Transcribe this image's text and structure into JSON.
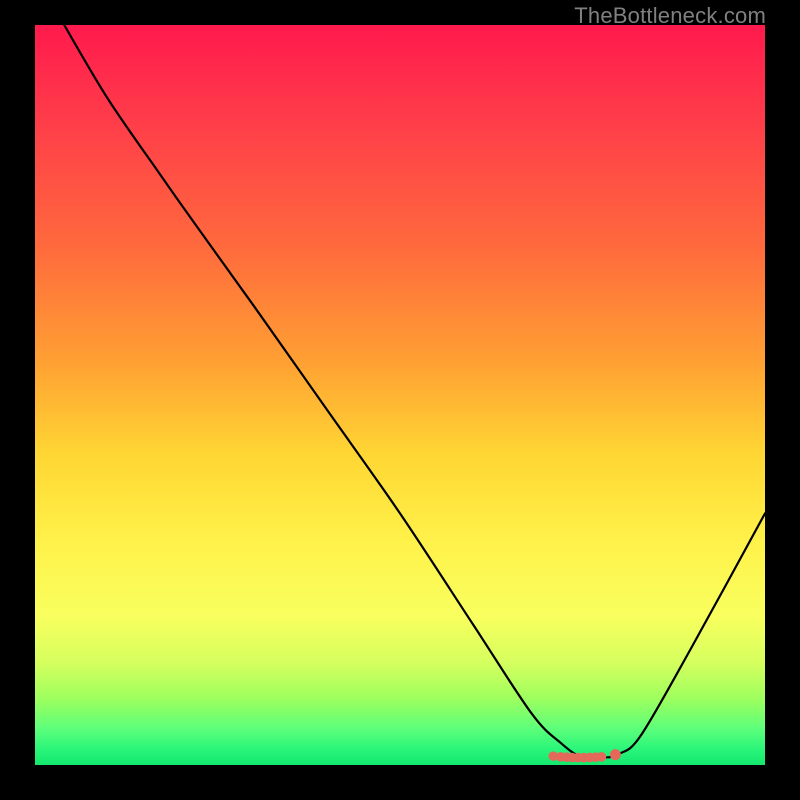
{
  "watermark": "TheBottleneck.com",
  "chart_data": {
    "type": "line",
    "title": "",
    "xlabel": "",
    "ylabel": "",
    "xlim": [
      0,
      100
    ],
    "ylim": [
      0,
      100
    ],
    "grid": false,
    "series": [
      {
        "name": "bottleneck-curve",
        "x": [
          4,
          10,
          17,
          22,
          30,
          40,
          50,
          60,
          68,
          72,
          75,
          78,
          80,
          83,
          90,
          100
        ],
        "y": [
          100,
          90,
          80,
          73,
          62,
          48,
          34,
          19,
          7,
          3,
          1,
          1,
          1.5,
          4,
          16,
          34
        ]
      }
    ],
    "markers": {
      "name": "optimal-region",
      "x": [
        71,
        72,
        72.8,
        73.6,
        74.4,
        75.2,
        76,
        76.8,
        77.6,
        79.5
      ],
      "y": [
        1.2,
        1.1,
        1.05,
        1.0,
        1.0,
        1.0,
        1.02,
        1.05,
        1.1,
        1.4
      ],
      "color": "#e4695a"
    }
  }
}
